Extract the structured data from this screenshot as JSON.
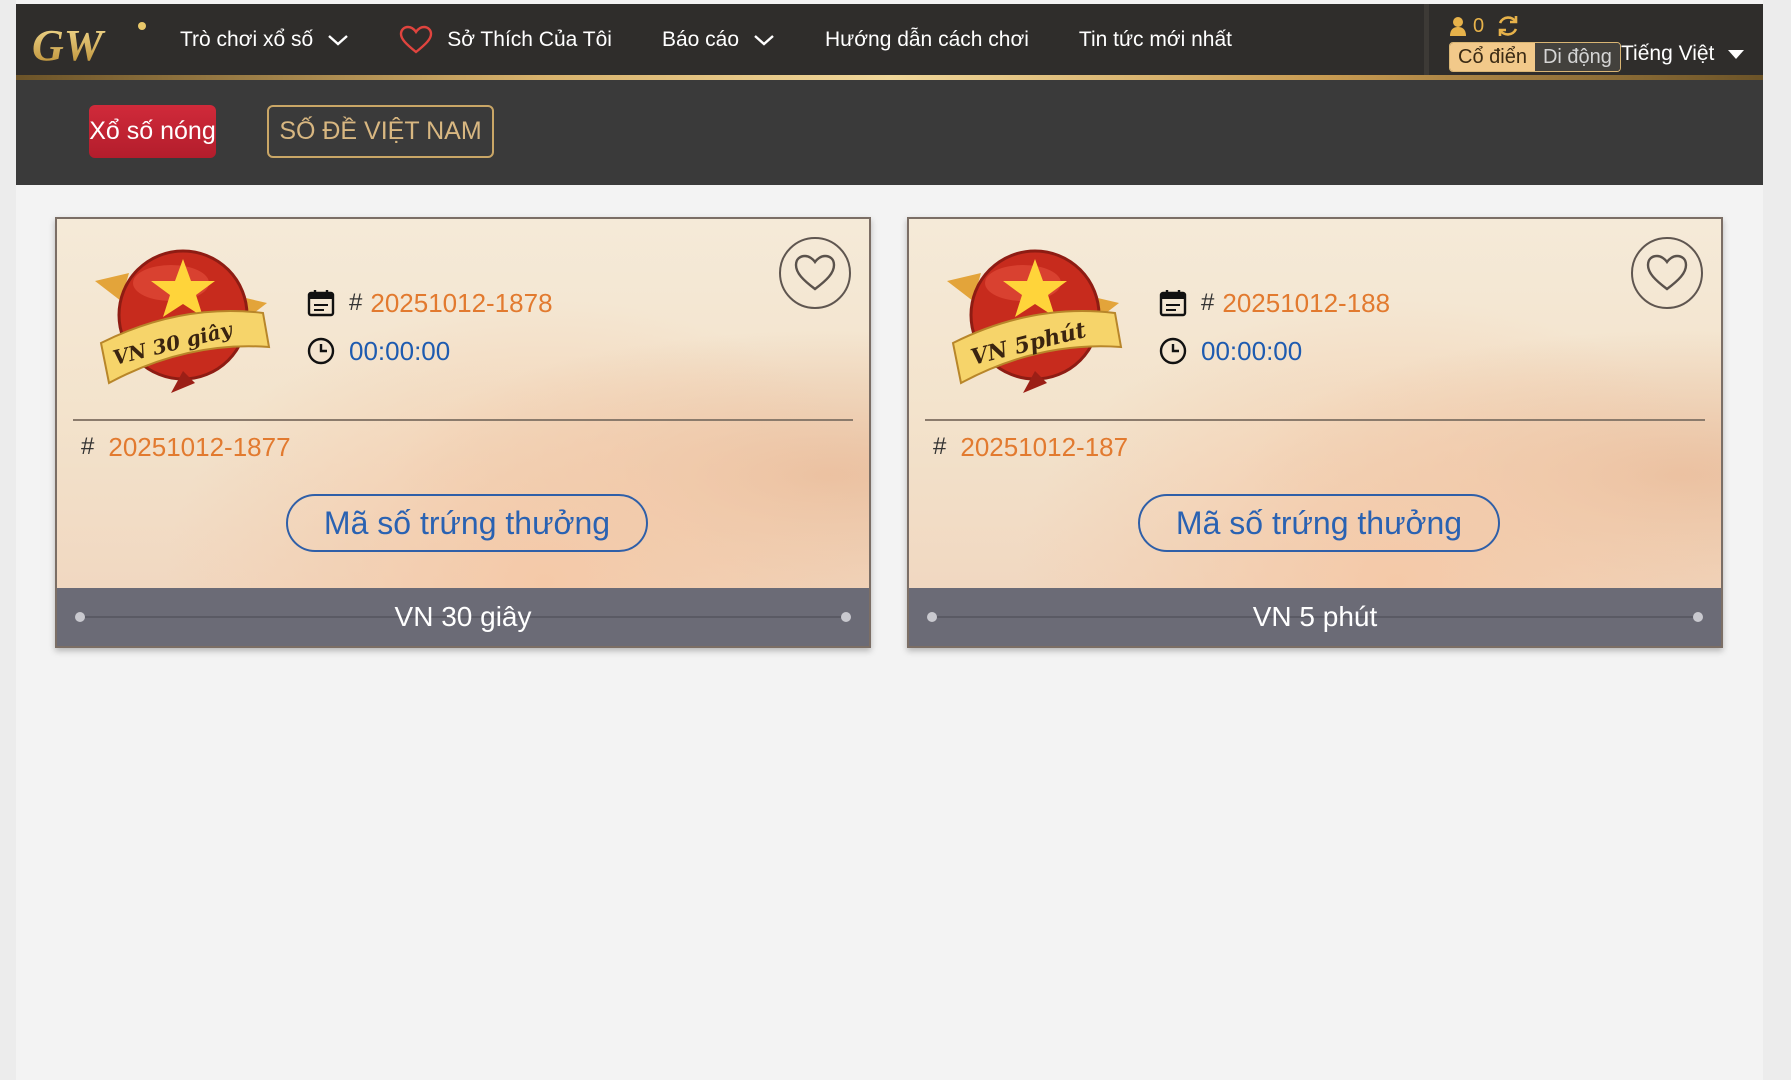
{
  "logo": {
    "text": "GW"
  },
  "nav": {
    "items": [
      {
        "label": "Trò chơi xổ số",
        "has_dropdown": true
      },
      {
        "label": "Sở Thích Của Tôi",
        "icon": "heart-icon"
      },
      {
        "label": "Báo cáo",
        "has_dropdown": true
      },
      {
        "label": "Hướng dẫn cách chơi"
      },
      {
        "label": "Tin tức mới nhất"
      }
    ]
  },
  "account": {
    "count": "0",
    "mode_active": "Cổ điển",
    "mode_inactive": "Di động",
    "language": "Tiếng Việt"
  },
  "subbar": {
    "hot_label": "Xổ số nóng",
    "category_label": "SỐ ĐỀ VIỆT NAM"
  },
  "cards": [
    {
      "badge_text": "VN 30 giây",
      "current_draw": "20251012-1878",
      "countdown": "00:00:00",
      "previous_draw": "20251012-1877",
      "winning_button": "Mã số trứng thưởng",
      "title": "VN 30 giây"
    },
    {
      "badge_text": "VN 5phút",
      "current_draw": "20251012-188",
      "countdown": "00:00:00",
      "previous_draw": "20251012-187",
      "winning_button": "Mã số trứng thưởng",
      "title": "VN 5 phút"
    }
  ],
  "colors": {
    "accent_gold": "#d8b26c",
    "hot_red": "#c42434",
    "draw_orange": "#e27a2f",
    "time_blue": "#1e5bb0"
  }
}
